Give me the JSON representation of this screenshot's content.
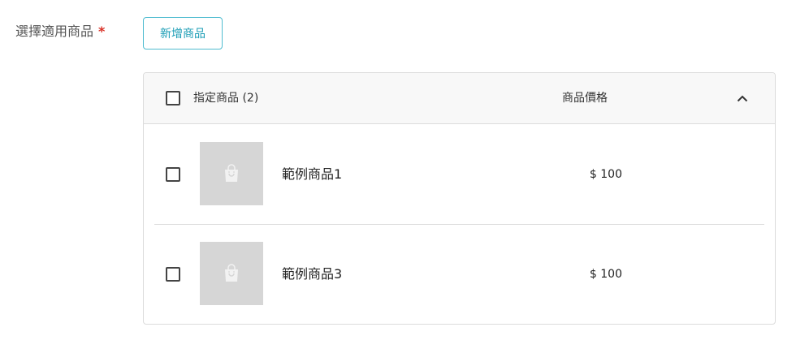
{
  "field": {
    "label": "選擇適用商品",
    "required_mark": "*"
  },
  "add_button": {
    "label": "新增商品"
  },
  "table": {
    "header_title": "指定商品 (2)",
    "price_column": "商品價格",
    "rows": [
      {
        "name": "範例商品1",
        "price": "$ 100"
      },
      {
        "name": "範例商品3",
        "price": "$ 100"
      }
    ]
  },
  "icons": {
    "collapse": "chevron-up-icon",
    "thumbnail": "shopping-bag-icon"
  },
  "colors": {
    "accent": "#1a9cb5",
    "required": "#d93025",
    "placeholder": "#d6d6d6"
  }
}
